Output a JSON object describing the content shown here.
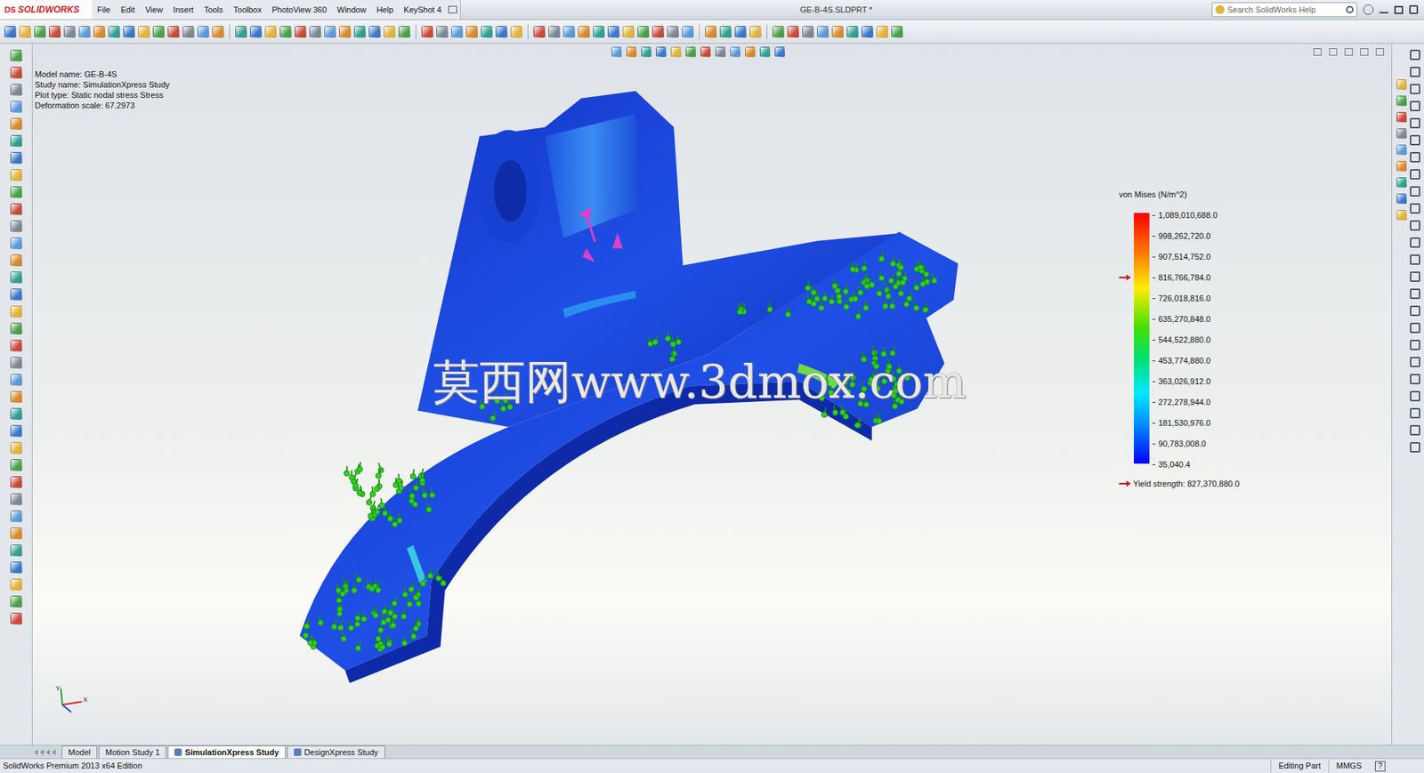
{
  "window": {
    "title": "GE-B-4S.SLDPRT *"
  },
  "logo": {
    "mark": "DS",
    "name": "SOLIDWORKS"
  },
  "menu": [
    "File",
    "Edit",
    "View",
    "Insert",
    "Tools",
    "Toolbox",
    "PhotoView 360",
    "Window",
    "Help",
    "KeyShot 4"
  ],
  "search": {
    "placeholder": "Search SolidWorks Help"
  },
  "plot_info": [
    "Model name: GE-B-4S",
    "Study name: SimulationXpress Study",
    "Plot type: Static nodal stress Stress",
    "Deformation scale: 67.2973"
  ],
  "legend": {
    "title": "von Mises (N/m^2)",
    "values": [
      {
        "text": "1,089,010,688.0",
        "marked": false
      },
      {
        "text": "998,262,720.0",
        "marked": false
      },
      {
        "text": "907,514,752.0",
        "marked": false
      },
      {
        "text": "816,766,784.0",
        "marked": true
      },
      {
        "text": "726,018,816.0",
        "marked": false
      },
      {
        "text": "635,270,848.0",
        "marked": false
      },
      {
        "text": "544,522,880.0",
        "marked": false
      },
      {
        "text": "453,774,880.0",
        "marked": false
      },
      {
        "text": "363,026,912.0",
        "marked": false
      },
      {
        "text": "272,278,944.0",
        "marked": false
      },
      {
        "text": "181,530,976.0",
        "marked": false
      },
      {
        "text": "90,783,008.0",
        "marked": false
      },
      {
        "text": "35,040.4",
        "marked": false
      }
    ],
    "yield_strength": "Yield strength: 827,370,880.0"
  },
  "watermark": "莫西网www.3dmox.com",
  "triad": {
    "labels": [
      "Y",
      "X"
    ]
  },
  "tabs": [
    {
      "label": "Model",
      "selected": false
    },
    {
      "label": "Motion Study 1",
      "selected": false
    },
    {
      "label": "SimulationXpress Study",
      "selected": true
    },
    {
      "label": "DesignXpress Study",
      "selected": false
    }
  ],
  "status_bar": {
    "edition": "SolidWorks Premium 2013 x64 Edition",
    "mode": "Editing Part",
    "units": "MMGS",
    "help": "?"
  }
}
